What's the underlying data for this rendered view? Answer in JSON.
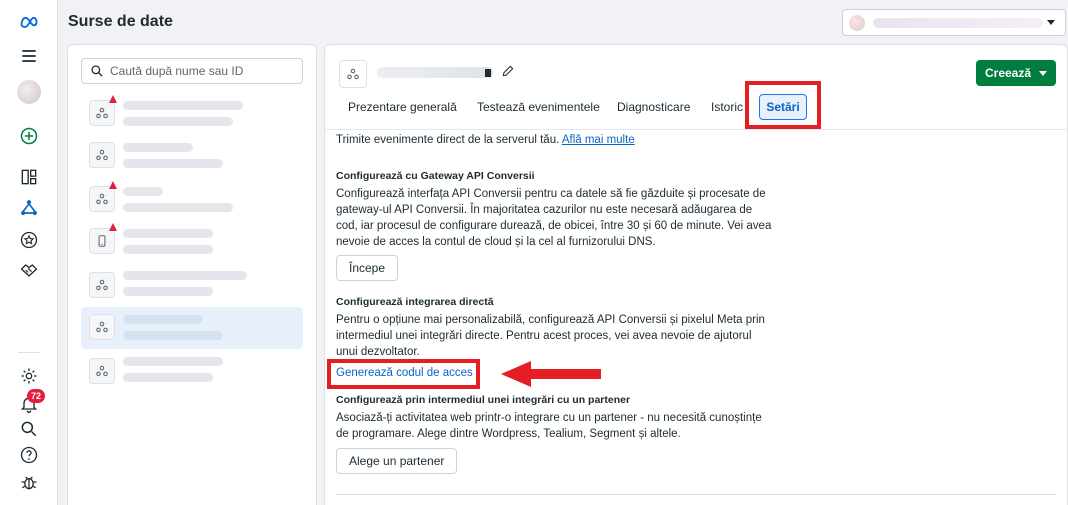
{
  "app": {
    "title": "Surse de date"
  },
  "rail": {
    "icons": [
      "meta-logo-icon",
      "menu-icon",
      "avatar",
      "add-circle-icon",
      "dashboard-icon",
      "events-manager-icon",
      "star-badge-icon",
      "handshake-icon",
      "settings-icon",
      "notifications-icon",
      "search-icon",
      "help-icon",
      "bug-icon"
    ],
    "notification_count": "72"
  },
  "colors": {
    "accent": "#0a66c2",
    "create": "#007d3f",
    "highlight": "#e41e22",
    "warning": "#e41e3f"
  },
  "list": {
    "search_placeholder": "Caută după nume sau ID",
    "items": [
      {
        "icon": "pixel-icon",
        "warning": true
      },
      {
        "icon": "pixel-icon",
        "warning": false
      },
      {
        "icon": "pixel-icon",
        "warning": true
      },
      {
        "icon": "app-icon",
        "warning": true
      },
      {
        "icon": "pixel-icon",
        "warning": false
      },
      {
        "icon": "pixel-icon",
        "warning": false,
        "selected": true
      },
      {
        "icon": "pixel-icon",
        "warning": false
      }
    ]
  },
  "main": {
    "create_label": "Creează",
    "tabs": [
      "Prezentare generală",
      "Testează evenimentele",
      "Diagnosticare",
      "Istoric",
      "Setări"
    ],
    "active_tab": "Setări",
    "intro_text": "Trimite evenimente direct de la serverul tău.",
    "intro_link": "Află mai multe",
    "gateway": {
      "heading": "Configurează cu Gateway API Conversii",
      "body": "Configurează interfața API Conversii pentru ca datele să fie găzduite și procesate de gateway-ul API Conversii. În majoritatea cazurilor nu este necesară adăugarea de cod, iar procesul de configurare durează, de obicei, între 30 și 60 de minute. Vei avea nevoie de acces la contul de cloud și la cel al furnizorului DNS.",
      "button": "Începe"
    },
    "direct": {
      "heading": "Configurează integrarea directă",
      "body": "Pentru o opțiune mai personalizabilă, configurează API Conversii și pixelul Meta prin intermediul unei integrări directe. Pentru acest proces, vei avea nevoie de ajutorul unui dezvoltator.",
      "link": "Generează codul de acces"
    },
    "partner": {
      "heading": "Configurează prin intermediul unei integrări cu un partener",
      "body": "Asociază-ți activitatea web printr-o integrare cu un partener - nu necesită cunoștințe de programare. Alege dintre Wordpress, Tealium, Segment și altele.",
      "button": "Alege un partener"
    }
  }
}
